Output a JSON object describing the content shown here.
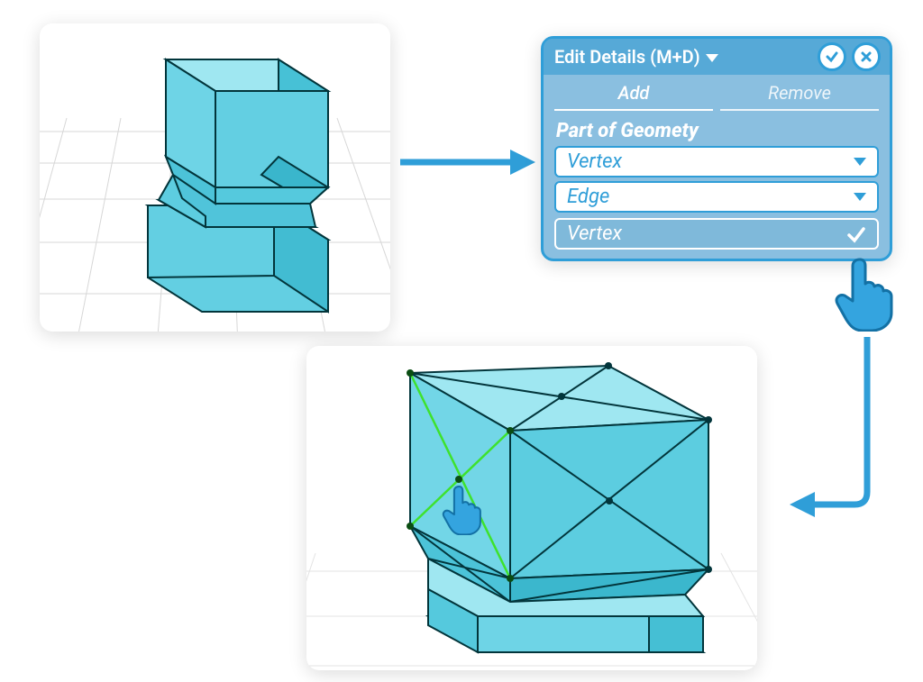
{
  "dialog": {
    "title": "Edit Details (M+D)",
    "tabs": {
      "add": "Add",
      "remove": "Remove"
    },
    "section_title": "Part of Geomety",
    "selected_value": "Vertex",
    "options": [
      "Edge",
      "Vertex"
    ]
  },
  "colors": {
    "accent": "#2f9ed8",
    "panel": "#8abfe0",
    "shape_face": "#6ed4e6",
    "shape_edge": "#02353b",
    "highlight": "#3ee22d"
  }
}
